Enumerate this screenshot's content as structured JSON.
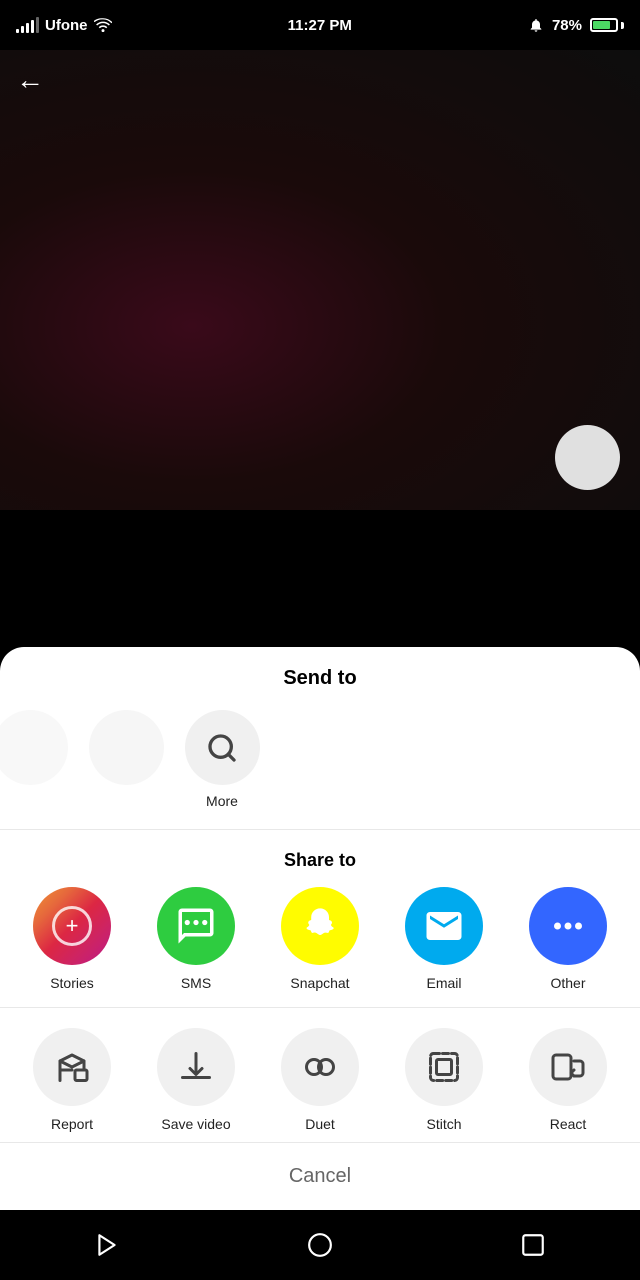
{
  "statusBar": {
    "carrier": "Ufone",
    "time": "11:27 PM",
    "battery": "78%",
    "wifi": true
  },
  "header": {
    "backLabel": "←"
  },
  "sendTo": {
    "title": "Send to",
    "more": {
      "label": "More"
    }
  },
  "shareTo": {
    "title": "Share to",
    "items": [
      {
        "id": "stories",
        "label": "Stories",
        "iconClass": "icon-stories"
      },
      {
        "id": "sms",
        "label": "SMS",
        "iconClass": "icon-sms"
      },
      {
        "id": "snapchat",
        "label": "Snapchat",
        "iconClass": "icon-snapchat"
      },
      {
        "id": "email",
        "label": "Email",
        "iconClass": "icon-email"
      },
      {
        "id": "other",
        "label": "Other",
        "iconClass": "icon-other"
      }
    ]
  },
  "actions": {
    "items": [
      {
        "id": "report",
        "label": "Report"
      },
      {
        "id": "save-video",
        "label": "Save video"
      },
      {
        "id": "duet",
        "label": "Duet"
      },
      {
        "id": "stitch",
        "label": "Stitch"
      },
      {
        "id": "react",
        "label": "React"
      }
    ]
  },
  "cancel": {
    "label": "Cancel"
  }
}
